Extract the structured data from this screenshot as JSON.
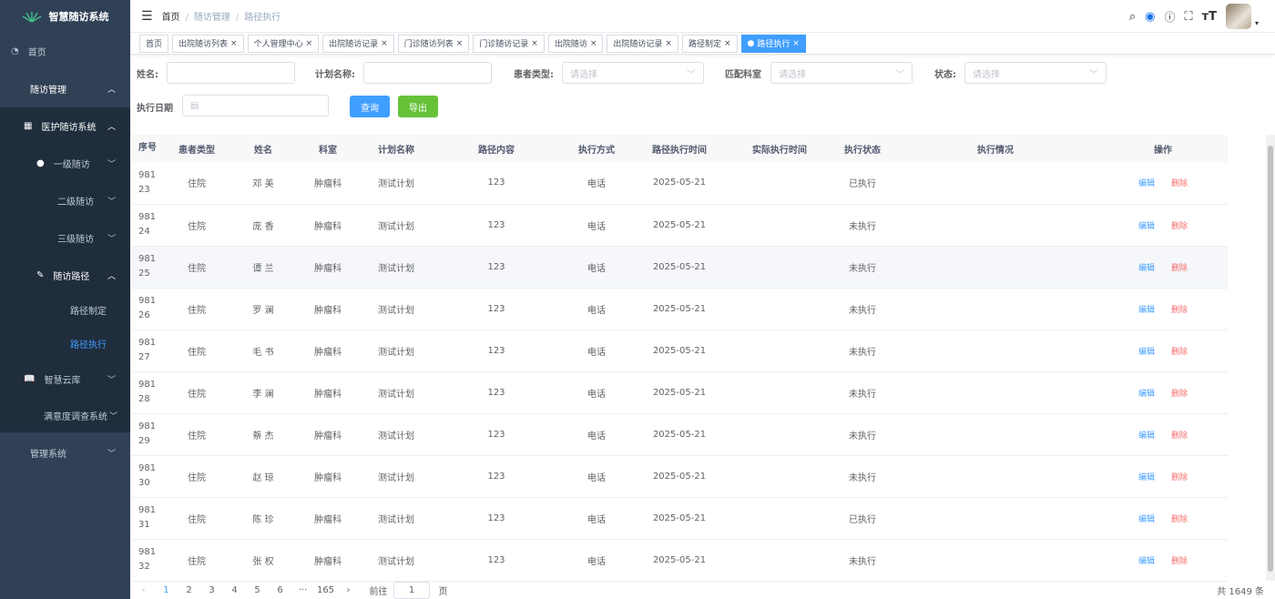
{
  "app": {
    "title": "智慧随访系统"
  },
  "sidebar": {
    "items": [
      {
        "label": "首页",
        "icon": "dashboard-icon"
      },
      {
        "label": "随访管理"
      },
      {
        "label": "医护随访系统",
        "icon": "table-icon"
      },
      {
        "label": "一级随访",
        "icon": "user-icon"
      },
      {
        "label": "二级随访"
      },
      {
        "label": "三级随访"
      },
      {
        "label": "随访路径",
        "icon": "edit-icon"
      },
      {
        "label": "路径制定"
      },
      {
        "label": "路径执行"
      },
      {
        "label": "智慧云库",
        "icon": "book-icon"
      },
      {
        "label": "满意度调查系统"
      },
      {
        "label": "管理系统"
      }
    ]
  },
  "breadcrumb": [
    "首页",
    "随访管理",
    "路径执行"
  ],
  "tabs": [
    "首页",
    "出院随访列表",
    "个人管理中心",
    "出院随访记录",
    "门诊随访列表",
    "门诊随访记录",
    "出院随访",
    "出院随访记录",
    "路径制定",
    "路径执行"
  ],
  "filters": {
    "name_label": "姓名:",
    "plan_label": "计划名称:",
    "patient_type_label": "患者类型:",
    "patient_type_placeholder": "请选择",
    "dept_label": "匹配科室",
    "dept_placeholder": "请选择",
    "status_label": "状态:",
    "status_placeholder": "请选择",
    "date_label": "执行日期",
    "query": "查询",
    "export": "导出"
  },
  "colors": {
    "accent": "#409eff",
    "success": "#67c23a",
    "danger": "#f56c6c",
    "sidebar": "#304156"
  },
  "table": {
    "columns": [
      "序号",
      "患者类型",
      "姓名",
      "科室",
      "计划名称",
      "路径内容",
      "执行方式",
      "路径执行时间",
      "实际执行时间",
      "执行状态",
      "执行情况",
      "操作"
    ],
    "rows": [
      [
        "98123",
        "住院",
        "邓 美",
        "肿瘤科",
        "测试计划",
        "123",
        "电话",
        "2025-05-21",
        "",
        "已执行",
        ""
      ],
      [
        "98124",
        "住院",
        "庞 香",
        "肿瘤科",
        "测试计划",
        "123",
        "电话",
        "2025-05-21",
        "",
        "未执行",
        ""
      ],
      [
        "98125",
        "住院",
        "谭 兰",
        "肿瘤科",
        "测试计划",
        "123",
        "电话",
        "2025-05-21",
        "",
        "未执行",
        ""
      ],
      [
        "98126",
        "住院",
        "罗 澜",
        "肿瘤科",
        "测试计划",
        "123",
        "电话",
        "2025-05-21",
        "",
        "未执行",
        ""
      ],
      [
        "98127",
        "住院",
        "毛 书",
        "肿瘤科",
        "测试计划",
        "123",
        "电话",
        "2025-05-21",
        "",
        "未执行",
        ""
      ],
      [
        "98128",
        "住院",
        "李 澜",
        "肿瘤科",
        "测试计划",
        "123",
        "电话",
        "2025-05-21",
        "",
        "未执行",
        ""
      ],
      [
        "98129",
        "住院",
        "蔡 杰",
        "肿瘤科",
        "测试计划",
        "123",
        "电话",
        "2025-05-21",
        "",
        "未执行",
        ""
      ],
      [
        "98130",
        "住院",
        "赵 琼",
        "肿瘤科",
        "测试计划",
        "123",
        "电话",
        "2025-05-21",
        "",
        "未执行",
        ""
      ],
      [
        "98131",
        "住院",
        "陈 珍",
        "肿瘤科",
        "测试计划",
        "123",
        "电话",
        "2025-05-21",
        "",
        "已执行",
        ""
      ],
      [
        "98132",
        "住院",
        "张 权",
        "肿瘤科",
        "测试计划",
        "123",
        "电话",
        "2025-05-21",
        "",
        "未执行",
        ""
      ]
    ],
    "edit": "编辑",
    "delete": "删除"
  },
  "pagination": {
    "pages": [
      "1",
      "2",
      "3",
      "4",
      "5",
      "6",
      "···",
      "165"
    ],
    "current": "1",
    "goto_label": "前往",
    "goto_value": "1",
    "page_unit": "页",
    "total": "共 1649 条"
  }
}
